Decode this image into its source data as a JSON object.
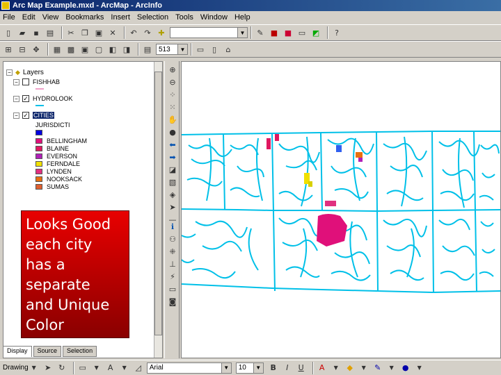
{
  "window": {
    "title": "Arc Map Example.mxd - ArcMap - ArcInfo"
  },
  "menu": [
    "File",
    "Edit",
    "View",
    "Bookmarks",
    "Insert",
    "Selection",
    "Tools",
    "Window",
    "Help"
  ],
  "toolbar2": {
    "scale_value": "513"
  },
  "toc": {
    "root_label": "Layers",
    "layers": [
      {
        "name": "FISHHAB",
        "checked": false,
        "symbol": "#f0a0c8"
      },
      {
        "name": "HYDROLOOK",
        "checked": true,
        "symbol": "#00c0e8"
      },
      {
        "name": "CITIES",
        "checked": true,
        "field": "JURISDICTI",
        "classes": [
          {
            "label": "",
            "color": "#0000e0"
          },
          {
            "label": "BELLINGHAM",
            "color": "#e0107a"
          },
          {
            "label": "BLAINE",
            "color": "#e01860"
          },
          {
            "label": "EVERSON",
            "color": "#b020b8"
          },
          {
            "label": "FERNDALE",
            "color": "#f0e000"
          },
          {
            "label": "LYNDEN",
            "color": "#e03080"
          },
          {
            "label": "NOOKSACK",
            "color": "#e87010"
          },
          {
            "label": "SUMAS",
            "color": "#e06030"
          }
        ]
      }
    ],
    "tabs": [
      "Display",
      "Source",
      "Selection"
    ]
  },
  "overlay": {
    "lines": [
      "Looks Good",
      "each city",
      "has a",
      "separate",
      "and Unique",
      "Color"
    ]
  },
  "statusbar": {
    "drawing_label": "Drawing",
    "font_name": "Arial",
    "font_size": "10",
    "bold": "B",
    "italic": "I",
    "underline": "U"
  },
  "colors": {
    "hydro": "#00c0e8",
    "title_start": "#0a246a",
    "overlay": "#e80000"
  }
}
